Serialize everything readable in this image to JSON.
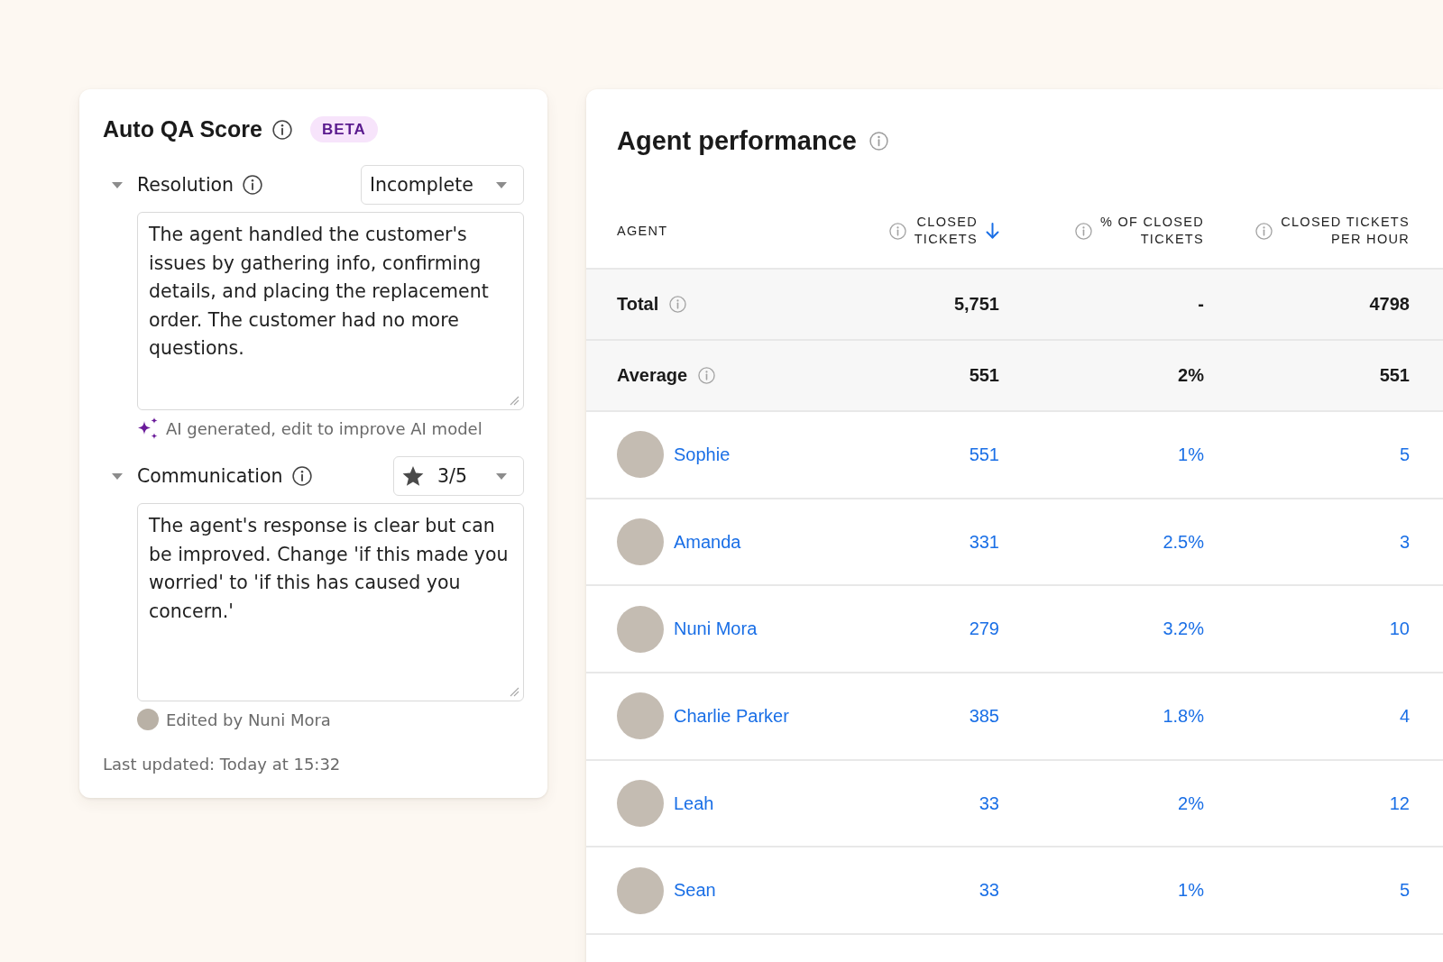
{
  "qa_card": {
    "title": "Auto QA Score",
    "badge": "BETA",
    "criteria": [
      {
        "kind": "select",
        "label": "Resolution",
        "expanded": true,
        "value": "Incomplete",
        "comment": "The agent handled the customer's issues by gathering info, confirming details, and placing the replacement order. The customer had no more questions.",
        "note": {
          "kind": "ai",
          "text": "AI generated, edit to improve AI model"
        }
      },
      {
        "kind": "rating",
        "label": "Communication",
        "expanded": true,
        "value": "3/5",
        "comment": "The agent's response is clear but can be improved. Change 'if this made you worried' to 'if this has caused you concern.'",
        "note": {
          "kind": "edited",
          "text": "Edited by Nuni Mora"
        }
      }
    ],
    "last_updated": "Last updated: Today at 15:32"
  },
  "performance": {
    "title": "Agent performance",
    "columns": [
      {
        "label_lines": [
          "AGENT"
        ],
        "info": false,
        "sorted": false
      },
      {
        "label_lines": [
          "CLOSED",
          "TICKETS"
        ],
        "info": true,
        "sorted": true
      },
      {
        "label_lines": [
          "% OF CLOSED",
          "TICKETS"
        ],
        "info": true,
        "sorted": false
      },
      {
        "label_lines": [
          "CLOSED TICKETS",
          "PER HOUR"
        ],
        "info": true,
        "sorted": false
      }
    ],
    "summary_rows": [
      {
        "label": "Total",
        "values": [
          "5,751",
          "-",
          "4798"
        ]
      },
      {
        "label": "Average",
        "values": [
          "551",
          "2%",
          "551"
        ]
      }
    ],
    "rows": [
      {
        "name": "Sophie",
        "values": [
          "551",
          "1%",
          "5"
        ]
      },
      {
        "name": "Amanda",
        "values": [
          "331",
          "2.5%",
          "3"
        ]
      },
      {
        "name": "Nuni Mora",
        "values": [
          "279",
          "3.2%",
          "10"
        ]
      },
      {
        "name": "Charlie Parker",
        "values": [
          "385",
          "1.8%",
          "4"
        ]
      },
      {
        "name": "Leah",
        "values": [
          "33",
          "2%",
          "12"
        ]
      },
      {
        "name": "Sean",
        "values": [
          "33",
          "1%",
          "5"
        ]
      }
    ]
  }
}
